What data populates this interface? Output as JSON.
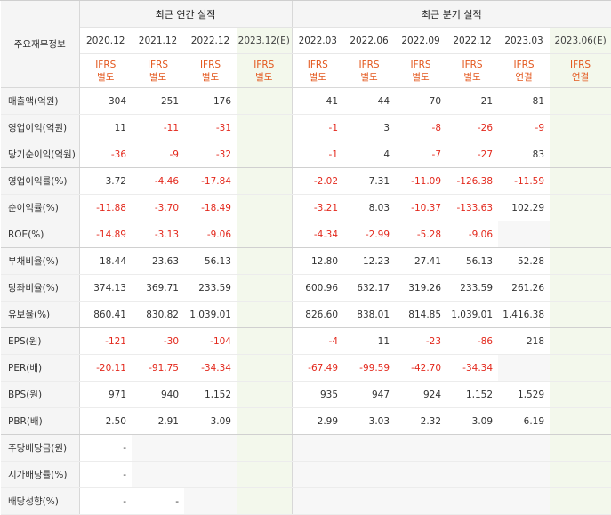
{
  "header": {
    "label_title": "주요재무정보",
    "annual_title": "최근 연간 실적",
    "quarter_title": "최근 분기 실적"
  },
  "periods": [
    {
      "label": "2020.12",
      "ifrs1": "IFRS",
      "ifrs2": "별도"
    },
    {
      "label": "2021.12",
      "ifrs1": "IFRS",
      "ifrs2": "별도"
    },
    {
      "label": "2022.12",
      "ifrs1": "IFRS",
      "ifrs2": "별도"
    },
    {
      "label": "2023.12(E)",
      "ifrs1": "IFRS",
      "ifrs2": "별도"
    },
    {
      "label": "2022.03",
      "ifrs1": "IFRS",
      "ifrs2": "별도"
    },
    {
      "label": "2022.06",
      "ifrs1": "IFRS",
      "ifrs2": "별도"
    },
    {
      "label": "2022.09",
      "ifrs1": "IFRS",
      "ifrs2": "별도"
    },
    {
      "label": "2022.12",
      "ifrs1": "IFRS",
      "ifrs2": "별도"
    },
    {
      "label": "2023.03",
      "ifrs1": "IFRS",
      "ifrs2": "연결"
    },
    {
      "label": "2023.06(E)",
      "ifrs1": "IFRS",
      "ifrs2": "연결"
    }
  ],
  "rows": [
    {
      "label": "매출액(억원)",
      "values": [
        "304",
        "251",
        "176",
        "",
        "41",
        "44",
        "70",
        "21",
        "81",
        ""
      ]
    },
    {
      "label": "영업이익(억원)",
      "values": [
        "11",
        "-11",
        "-31",
        "",
        "-1",
        "3",
        "-8",
        "-26",
        "-9",
        ""
      ]
    },
    {
      "label": "당기순이익(억원)",
      "values": [
        "-36",
        "-9",
        "-32",
        "",
        "-1",
        "4",
        "-7",
        "-27",
        "83",
        ""
      ]
    },
    {
      "label": "영업이익률(%)",
      "values": [
        "3.72",
        "-4.46",
        "-17.84",
        "",
        "-2.02",
        "7.31",
        "-11.09",
        "-126.38",
        "-11.59",
        ""
      ]
    },
    {
      "label": "순이익률(%)",
      "values": [
        "-11.88",
        "-3.70",
        "-18.49",
        "",
        "-3.21",
        "8.03",
        "-10.37",
        "-133.63",
        "102.29",
        ""
      ]
    },
    {
      "label": "ROE(%)",
      "values": [
        "-14.89",
        "-3.13",
        "-9.06",
        "",
        "-4.34",
        "-2.99",
        "-5.28",
        "-9.06",
        "",
        ""
      ]
    },
    {
      "label": "부채비율(%)",
      "values": [
        "18.44",
        "23.63",
        "56.13",
        "",
        "12.80",
        "12.23",
        "27.41",
        "56.13",
        "52.28",
        ""
      ]
    },
    {
      "label": "당좌비율(%)",
      "values": [
        "374.13",
        "369.71",
        "233.59",
        "",
        "600.96",
        "632.17",
        "319.26",
        "233.59",
        "261.26",
        ""
      ]
    },
    {
      "label": "유보율(%)",
      "values": [
        "860.41",
        "830.82",
        "1,039.01",
        "",
        "826.60",
        "838.01",
        "814.85",
        "1,039.01",
        "1,416.38",
        ""
      ]
    },
    {
      "label": "EPS(원)",
      "values": [
        "-121",
        "-30",
        "-104",
        "",
        "-4",
        "11",
        "-23",
        "-86",
        "218",
        ""
      ]
    },
    {
      "label": "PER(배)",
      "values": [
        "-20.11",
        "-91.75",
        "-34.34",
        "",
        "-67.49",
        "-99.59",
        "-42.70",
        "-34.34",
        "",
        ""
      ]
    },
    {
      "label": "BPS(원)",
      "values": [
        "971",
        "940",
        "1,152",
        "",
        "935",
        "947",
        "924",
        "1,152",
        "1,529",
        ""
      ]
    },
    {
      "label": "PBR(배)",
      "values": [
        "2.50",
        "2.91",
        "3.09",
        "",
        "2.99",
        "3.03",
        "2.32",
        "3.09",
        "6.19",
        ""
      ]
    },
    {
      "label": "주당배당금(원)",
      "values": [
        "-",
        "",
        "",
        "",
        "",
        "",
        "",
        "",
        "",
        ""
      ]
    },
    {
      "label": "시가배당률(%)",
      "values": [
        "-",
        "",
        "",
        "",
        "",
        "",
        "",
        "",
        "",
        ""
      ]
    },
    {
      "label": "배당성향(%)",
      "values": [
        "-",
        "-",
        "",
        "",
        "",
        "",
        "",
        "",
        "",
        ""
      ]
    }
  ],
  "colors": {
    "ifrs_text": "#e3571d",
    "negative_text": "#e3291d",
    "estimate_bg": "#f3f8ec",
    "label_bg": "#f5f5f5"
  }
}
